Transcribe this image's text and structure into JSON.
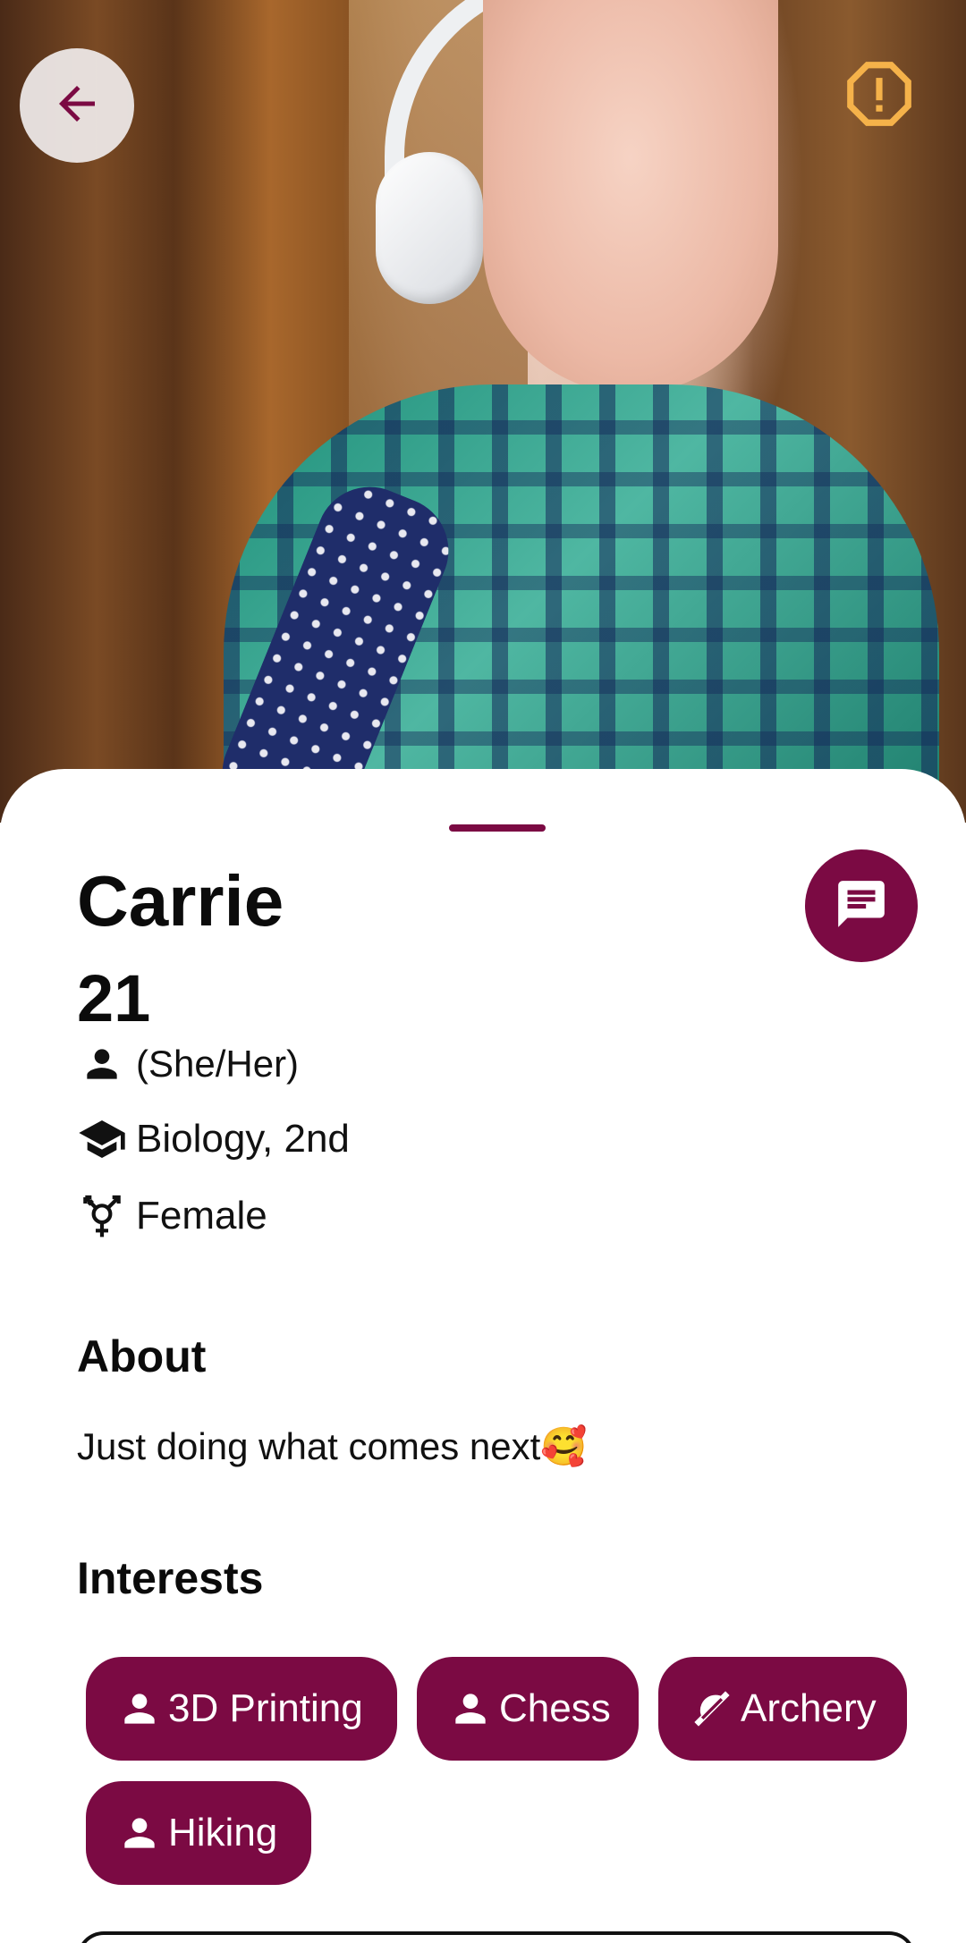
{
  "profile": {
    "name": "Carrie",
    "age": "21",
    "pronouns": "(She/Her)",
    "study": "Biology, 2nd",
    "gender": "Female"
  },
  "about": {
    "title": "About",
    "text": "Just doing what comes next🥰"
  },
  "interests": {
    "title": "Interests",
    "items": [
      {
        "label": "3D Printing",
        "icon": "person-icon"
      },
      {
        "label": "Chess",
        "icon": "person-icon"
      },
      {
        "label": "Archery",
        "icon": "sports-icon"
      },
      {
        "label": "Hiking",
        "icon": "person-icon"
      }
    ]
  },
  "icons": {
    "back": "arrow-left-icon",
    "report": "warning-octagon-icon",
    "chat": "chat-icon",
    "pronouns": "person-icon",
    "study": "graduation-cap-icon",
    "gender": "gender-icon"
  },
  "colors": {
    "accent": "#7b0a43",
    "report": "#f5b24a"
  }
}
